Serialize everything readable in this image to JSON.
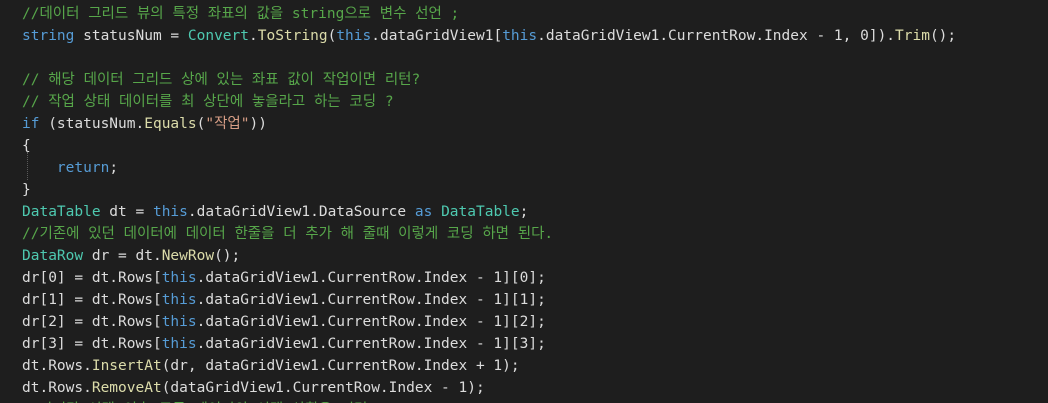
{
  "lines": [
    [
      {
        "t": "//데이터 그리드 뷰의 특정 좌표의 값을 string으로 변수 선언 ;",
        "c": "c"
      }
    ],
    [
      {
        "t": "string",
        "c": "k"
      },
      {
        "t": " statusNum = ",
        "c": "p"
      },
      {
        "t": "Convert",
        "c": "t"
      },
      {
        "t": ".",
        "c": "p"
      },
      {
        "t": "ToString",
        "c": "m"
      },
      {
        "t": "(",
        "c": "p"
      },
      {
        "t": "this",
        "c": "k"
      },
      {
        "t": ".dataGridView1[",
        "c": "p"
      },
      {
        "t": "this",
        "c": "k"
      },
      {
        "t": ".dataGridView1.CurrentRow.Index - 1, 0]).",
        "c": "p"
      },
      {
        "t": "Trim",
        "c": "m"
      },
      {
        "t": "();",
        "c": "p"
      }
    ],
    [],
    [
      {
        "t": "// 해당 데이터 그리드 상에 있는 좌표 값이 작업이면 리턴?",
        "c": "c"
      }
    ],
    [
      {
        "t": "// 작업 상태 데이터를 최 상단에 놓을라고 하는 코딩 ?",
        "c": "c"
      }
    ],
    [
      {
        "t": "if",
        "c": "k"
      },
      {
        "t": " (statusNum.",
        "c": "p"
      },
      {
        "t": "Equals",
        "c": "m"
      },
      {
        "t": "(",
        "c": "p"
      },
      {
        "t": "\"작업\"",
        "c": "s"
      },
      {
        "t": "))",
        "c": "p"
      }
    ],
    [
      {
        "t": "{",
        "c": "p"
      }
    ],
    [
      {
        "t": "    ",
        "c": "p"
      },
      {
        "t": "return",
        "c": "k"
      },
      {
        "t": ";",
        "c": "p"
      }
    ],
    [
      {
        "t": "}",
        "c": "p"
      }
    ],
    [
      {
        "t": "DataTable",
        "c": "t"
      },
      {
        "t": " dt = ",
        "c": "p"
      },
      {
        "t": "this",
        "c": "k"
      },
      {
        "t": ".dataGridView1.DataSource ",
        "c": "p"
      },
      {
        "t": "as",
        "c": "k"
      },
      {
        "t": " ",
        "c": "p"
      },
      {
        "t": "DataTable",
        "c": "t"
      },
      {
        "t": ";",
        "c": "p"
      }
    ],
    [
      {
        "t": "//기존에 있던 데이터에 데이터 한줄을 더 추가 해 줄때 이렇게 코딩 하면 된다.",
        "c": "c"
      }
    ],
    [
      {
        "t": "DataRow",
        "c": "t"
      },
      {
        "t": " dr = dt.",
        "c": "p"
      },
      {
        "t": "NewRow",
        "c": "m"
      },
      {
        "t": "();",
        "c": "p"
      }
    ],
    [
      {
        "t": "dr[0] = dt.Rows[",
        "c": "p"
      },
      {
        "t": "this",
        "c": "k"
      },
      {
        "t": ".dataGridView1.CurrentRow.Index - 1][0];",
        "c": "p"
      }
    ],
    [
      {
        "t": "dr[1] = dt.Rows[",
        "c": "p"
      },
      {
        "t": "this",
        "c": "k"
      },
      {
        "t": ".dataGridView1.CurrentRow.Index - 1][1];",
        "c": "p"
      }
    ],
    [
      {
        "t": "dr[2] = dt.Rows[",
        "c": "p"
      },
      {
        "t": "this",
        "c": "k"
      },
      {
        "t": ".dataGridView1.CurrentRow.Index - 1][2];",
        "c": "p"
      }
    ],
    [
      {
        "t": "dr[3] = dt.Rows[",
        "c": "p"
      },
      {
        "t": "this",
        "c": "k"
      },
      {
        "t": ".dataGridView1.CurrentRow.Index - 1][3];",
        "c": "p"
      }
    ],
    [
      {
        "t": "dt.Rows.",
        "c": "p"
      },
      {
        "t": "InsertAt",
        "c": "m"
      },
      {
        "t": "(dr, dataGridView1.CurrentRow.Index + 1);",
        "c": "p"
      }
    ],
    [
      {
        "t": "dt.Rows.",
        "c": "p"
      },
      {
        "t": "RemoveAt",
        "c": "m"
      },
      {
        "t": "(dataGridView1.CurrentRow.Index - 1);",
        "c": "p"
      }
    ],
    [
      {
        "t": "//마지막 선택 이후 모든 데이터의 선택 상황을 리턴",
        "c": "c"
      }
    ]
  ]
}
